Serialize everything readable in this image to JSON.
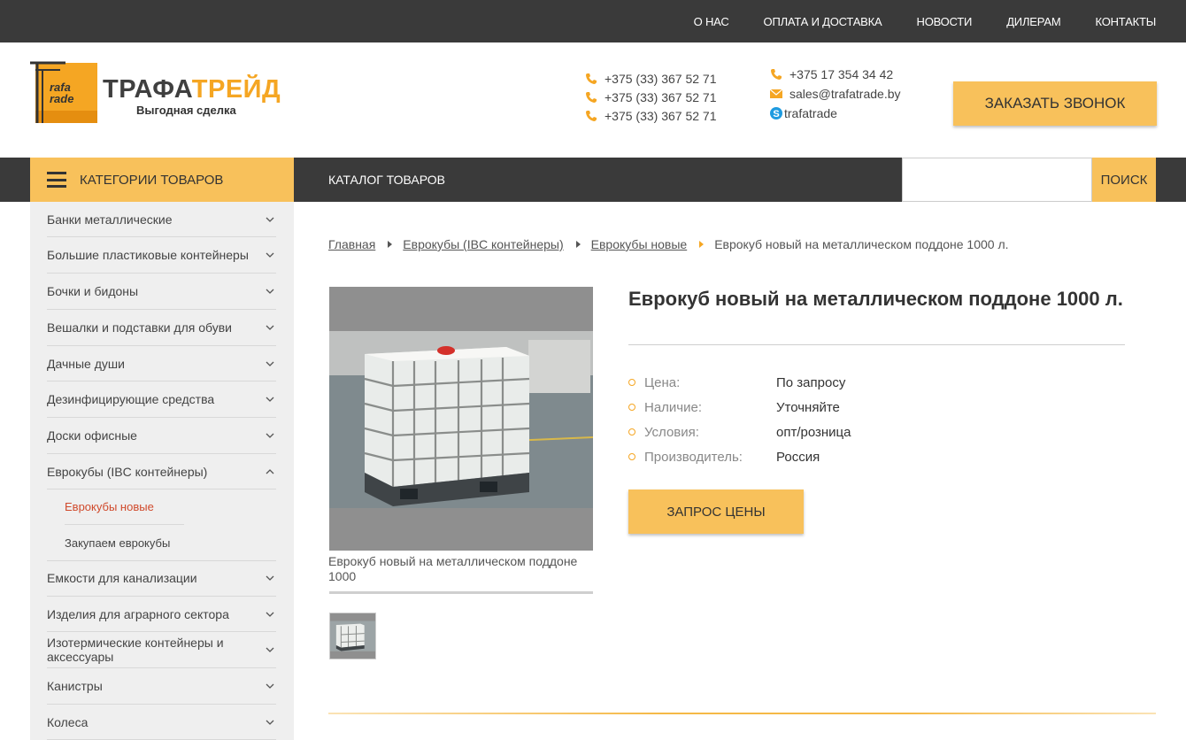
{
  "topnav": [
    "О НАС",
    "ОПЛАТА И ДОСТАВКА",
    "НОВОСТИ",
    "ДИЛЕРАМ",
    "КОНТАКТЫ"
  ],
  "logo": {
    "name_main": "ТРАФА",
    "name_accent": "ТРЕЙД",
    "slogan": "Выгодная сделка",
    "mark_text": [
      "rafa",
      "rade"
    ]
  },
  "phones": [
    "+375 (33) 367 52 71",
    "+375 (33) 367 52 71",
    "+375 (33) 367 52 71"
  ],
  "contacts": {
    "phone": "+375 17 354 34 42",
    "email": "sales@trafatrade.by",
    "skype": "trafatrade"
  },
  "callback_label": "ЗАКАЗАТЬ ЗВОНОК",
  "nav": {
    "categories_label": "КАТЕГОРИИ ТОВАРОВ",
    "catalog_label": "КАТАЛОГ ТОВАРОВ",
    "search_value": "",
    "search_button": "ПОИСК"
  },
  "sidebar": {
    "items": [
      "Банки металлические",
      "Большие пластиковые контейнеры",
      "Бочки и бидоны",
      "Вешалки и подставки для обуви",
      "Дачные души",
      "Дезинфицирующие средства",
      "Доски офисные",
      "Еврокубы (IBC контейнеры)"
    ],
    "subitems": [
      "Еврокубы новые",
      "Закупаем еврокубы"
    ],
    "items_after": [
      "Емкости для канализации",
      "Изделия для аграрного сектора",
      "Изотермические контейнеры и аксессуары",
      "Канистры",
      "Колеса"
    ]
  },
  "breadcrumb": [
    "Главная",
    "Еврокубы (IBC контейнеры)",
    "Еврокубы новые",
    "Еврокуб новый на металлическом поддоне 1000 л."
  ],
  "product": {
    "title": "Еврокуб новый на металлическом поддоне 1000 л.",
    "caption": "Еврокуб новый на металлическом поддоне 1000",
    "props": [
      {
        "key": "Цена:",
        "value": "По запросу"
      },
      {
        "key": "Наличие:",
        "value": "Уточняйте"
      },
      {
        "key": "Условия:",
        "value": "опт/розница"
      },
      {
        "key": "Производитель:",
        "value": "Россия"
      }
    ],
    "price_button": "ЗАПРОС ЦЕНЫ"
  },
  "colors": {
    "accent": "#f8c15b",
    "dark": "#3a3a3a",
    "active_link": "#d04a2c"
  }
}
